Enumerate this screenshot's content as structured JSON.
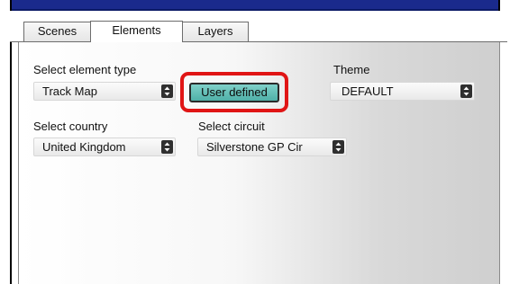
{
  "tabs": [
    {
      "label": "Scenes",
      "active": false
    },
    {
      "label": "Elements",
      "active": true
    },
    {
      "label": "Layers",
      "active": false
    }
  ],
  "element_type": {
    "label": "Select element type",
    "value": "Track Map"
  },
  "user_defined_button": {
    "label": "User defined"
  },
  "theme": {
    "label": "Theme",
    "value": "DEFAULT"
  },
  "country": {
    "label": "Select country",
    "value": "United Kingdom"
  },
  "circuit": {
    "label": "Select circuit",
    "value": "Silverstone GP Cir"
  },
  "colors": {
    "header": "#1a2a8c",
    "highlight": "#e01515",
    "button_teal": "#5fbfb6",
    "select_arrow": "#2f2f2f"
  }
}
